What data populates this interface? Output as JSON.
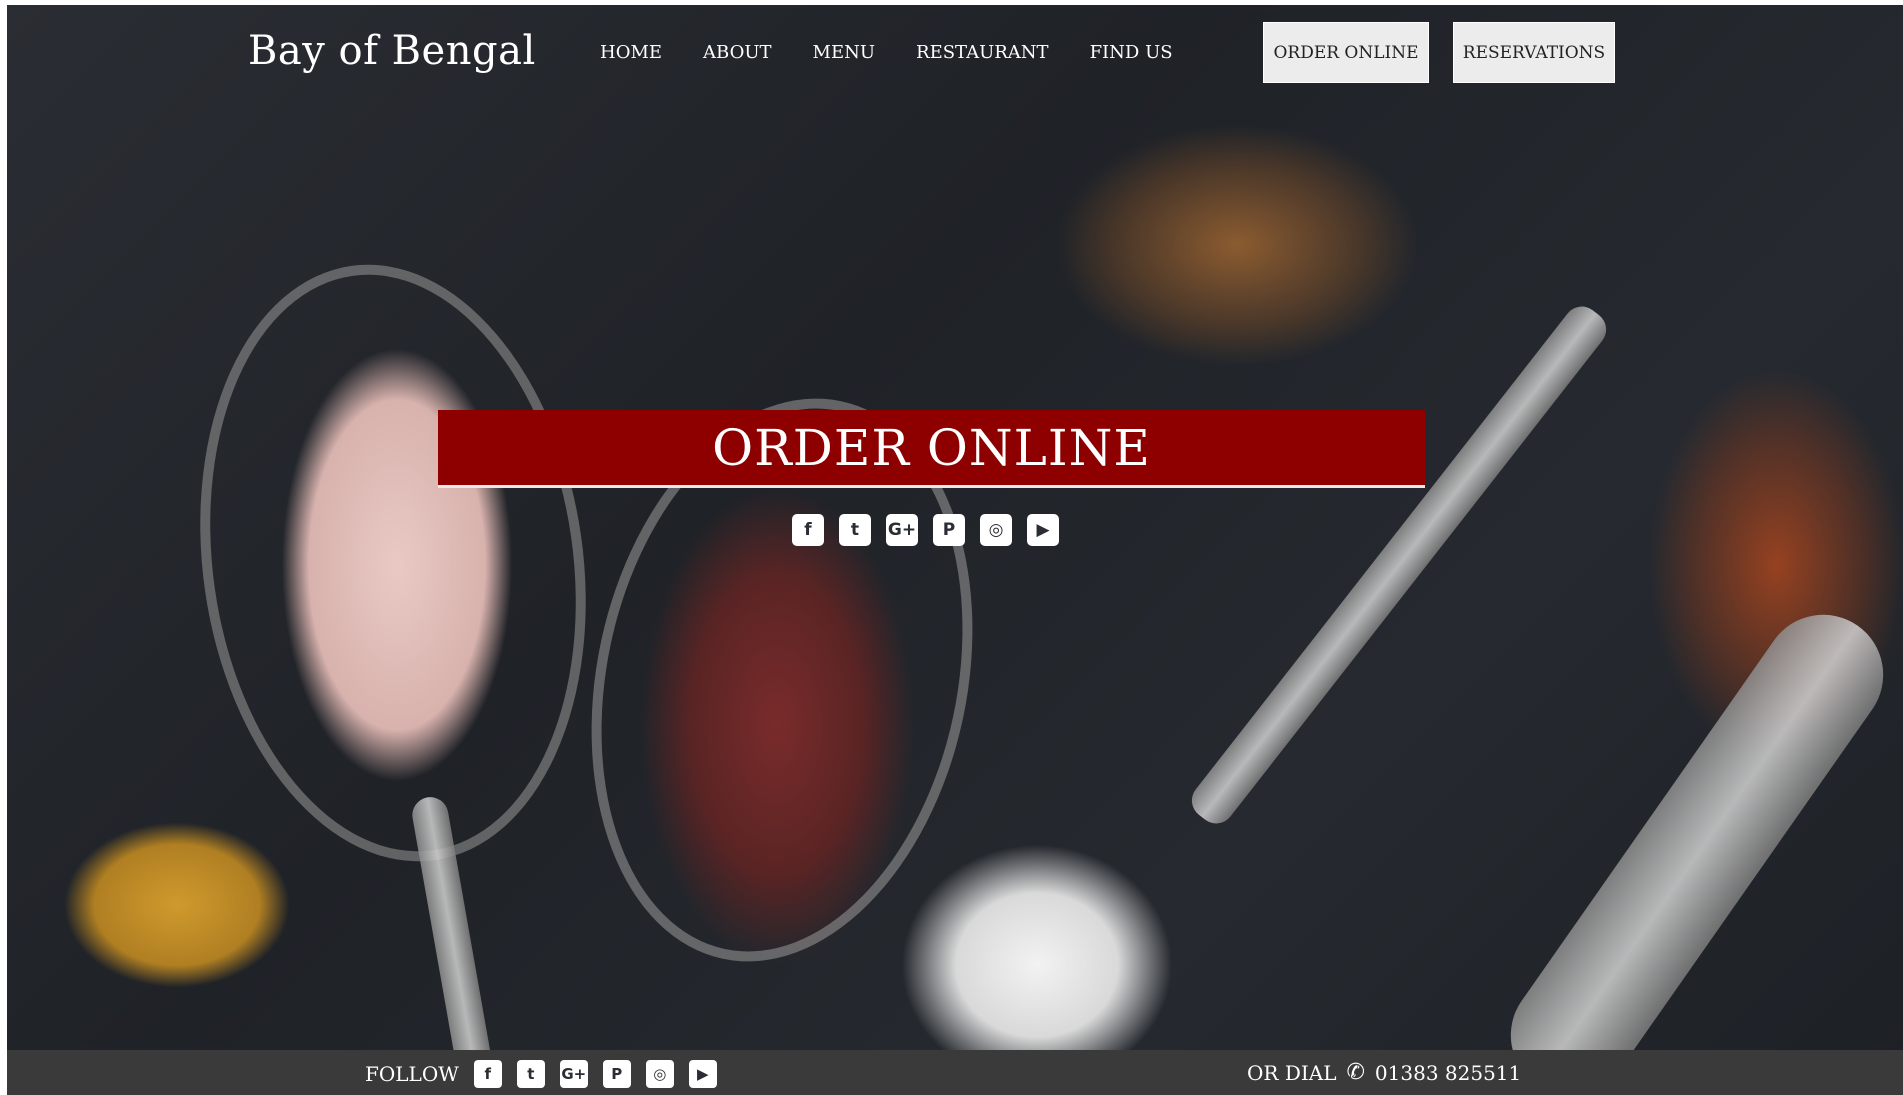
{
  "brand": {
    "name": "Bay of Bengal"
  },
  "nav": {
    "items": [
      {
        "label": "HOME"
      },
      {
        "label": "ABOUT"
      },
      {
        "label": "MENU"
      },
      {
        "label": "RESTAURANT"
      },
      {
        "label": "FIND US"
      }
    ]
  },
  "actions": {
    "order_label": "ORDER ONLINE",
    "reservations_label": "RESERVATIONS"
  },
  "hero": {
    "banner_text": "ORDER ONLINE",
    "banner_color": "#8e0000",
    "social_icons": [
      "facebook-icon",
      "twitter-icon",
      "google-plus-icon",
      "pinterest-icon",
      "instagram-icon",
      "youtube-icon"
    ]
  },
  "footer": {
    "follow_label": "FOLLOW",
    "dial_label": "OR DIAL",
    "phone": "01383 825511",
    "social_icons": [
      "facebook-icon",
      "twitter-icon",
      "google-plus-icon",
      "pinterest-icon",
      "instagram-icon",
      "youtube-icon"
    ]
  }
}
